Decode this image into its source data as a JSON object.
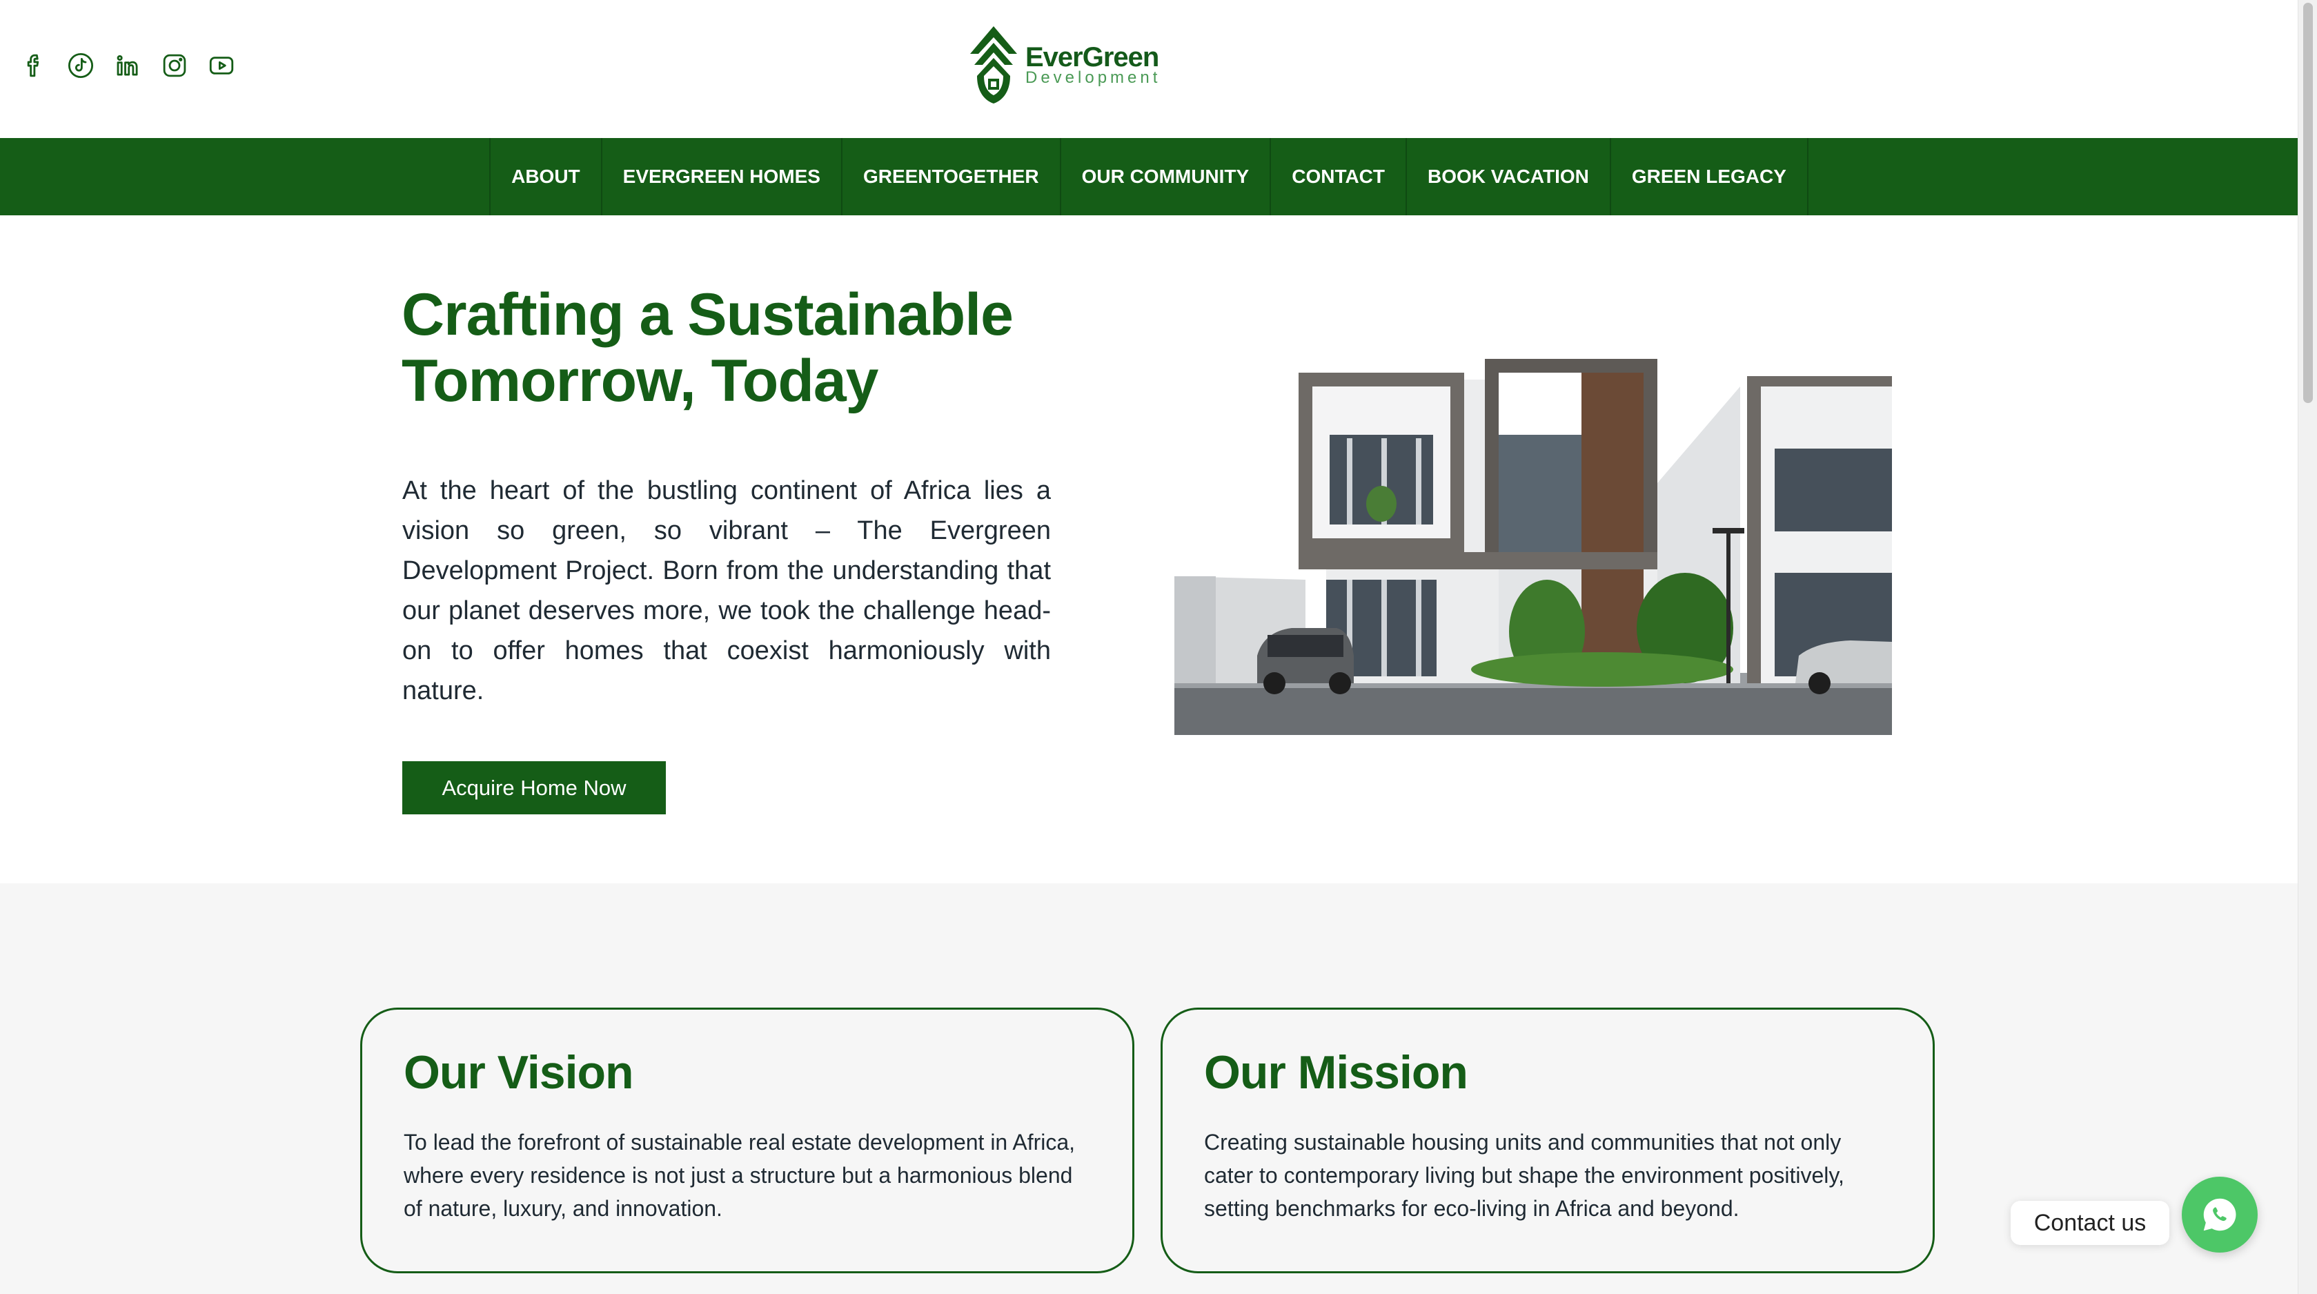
{
  "brand": {
    "name": "EverGreen",
    "sub": "Development",
    "primary_color": "#155d17",
    "accent_color": "#4dc767"
  },
  "socials": [
    {
      "icon": "facebook-icon"
    },
    {
      "icon": "tiktok-icon"
    },
    {
      "icon": "linkedin-icon"
    },
    {
      "icon": "instagram-icon"
    },
    {
      "icon": "youtube-icon"
    }
  ],
  "nav": {
    "items": [
      {
        "label": "ABOUT"
      },
      {
        "label": "EVERGREEN HOMES"
      },
      {
        "label": "GREENTOGETHER"
      },
      {
        "label": "OUR COMMUNITY"
      },
      {
        "label": "CONTACT"
      },
      {
        "label": "BOOK VACATION"
      },
      {
        "label": "GREEN LEGACY"
      }
    ]
  },
  "hero": {
    "title_line1": "Crafting a Sustainable",
    "title_line2": "Tomorrow, Today",
    "text": "At the heart of the bustling continent of Africa lies a vision so green, so vibrant – The Evergreen Development Project. Born from the understanding that our planet deserves more, we took the challenge head-on to offer homes that coexist harmoniously with nature.",
    "button_label": "Acquire Home Now"
  },
  "vision": {
    "title": "Our Vision",
    "text": "To lead the forefront of sustainable real estate development in Africa, where every residence is not just a structure but a harmonious blend of nature, luxury, and innovation."
  },
  "mission": {
    "title": "Our Mission",
    "text": "Creating sustainable housing units and communities that not only cater to contemporary living but shape the environment positively, setting benchmarks for eco-living in Africa and beyond."
  },
  "contact_widget": {
    "label": "Contact us",
    "icon": "whatsapp-icon"
  }
}
